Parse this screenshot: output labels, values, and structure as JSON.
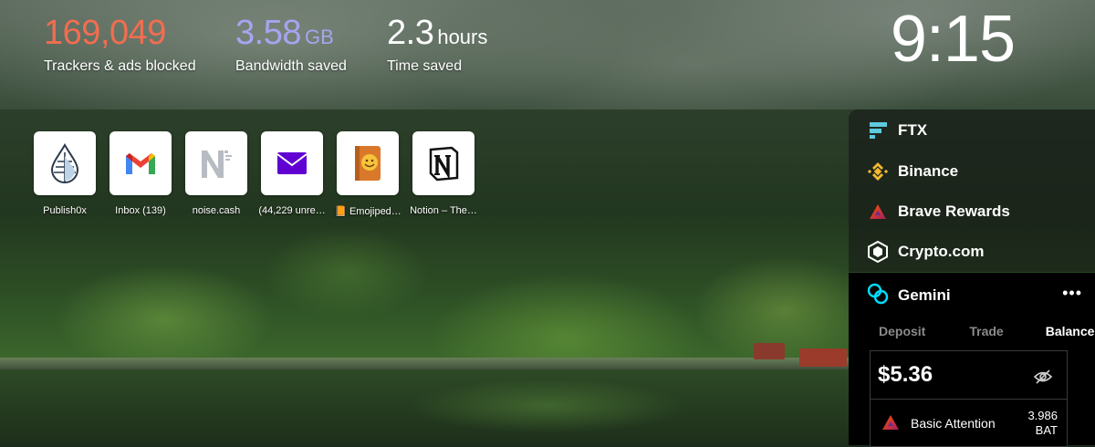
{
  "stats": {
    "trackers": {
      "value": "169,049",
      "label": "Trackers & ads blocked"
    },
    "bandwidth": {
      "value": "3.58",
      "unit": "GB",
      "label": "Bandwidth saved"
    },
    "time": {
      "value": "2.3",
      "unit": "hours",
      "label": "Time saved"
    }
  },
  "clock": "9:15",
  "top_sites": [
    {
      "name": "Publish0x",
      "icon": "publish0x-icon"
    },
    {
      "name": "Inbox (139)",
      "icon": "gmail-icon"
    },
    {
      "name": "noise.cash",
      "icon": "noise-cash-icon"
    },
    {
      "name": "(44,229 unre…",
      "icon": "yahoo-mail-icon"
    },
    {
      "name": "📙 Emojiped…",
      "icon": "emojipedia-icon"
    },
    {
      "name": "Notion – The…",
      "icon": "notion-icon"
    }
  ],
  "crypto_widget": {
    "items": [
      {
        "label": "FTX",
        "icon": "ftx-icon"
      },
      {
        "label": "Binance",
        "icon": "binance-icon"
      },
      {
        "label": "Brave Rewards",
        "icon": "brave-rewards-icon"
      },
      {
        "label": "Crypto.com",
        "icon": "crypto-com-icon"
      }
    ],
    "gemini": {
      "title": "Gemini",
      "more": "•••",
      "tabs": [
        "Deposit",
        "Trade",
        "Balance"
      ],
      "active_tab": "Balance",
      "balance": "$5.36",
      "asset": {
        "name": "Basic Attention",
        "amount": "3.986",
        "symbol": "BAT"
      }
    }
  },
  "colors": {
    "trackers": "#f26d50",
    "bandwidth": "#a7a4f2",
    "widget_bg": "#000000"
  }
}
